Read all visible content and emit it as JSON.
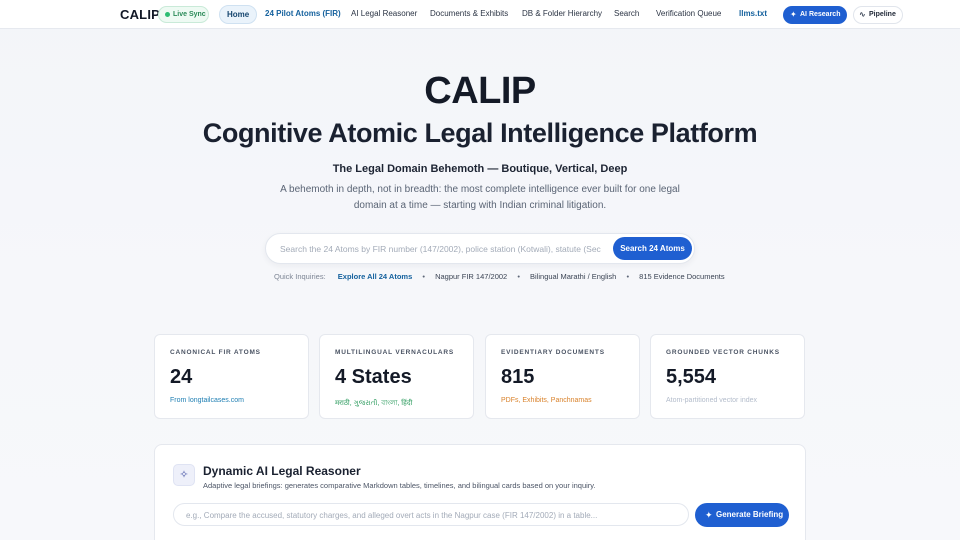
{
  "nav": {
    "brand": "CALIP",
    "live_badge": "Live Sync",
    "links": [
      {
        "label": "Home"
      },
      {
        "label": "24 Pilot Atoms (FIR)"
      },
      {
        "label": "AI Legal Reasoner"
      },
      {
        "label": "Documents & Exhibits"
      },
      {
        "label": "DB & Folder Hierarchy"
      },
      {
        "label": "Search"
      },
      {
        "label": "Verification Queue"
      },
      {
        "label": "llms.txt"
      }
    ],
    "research_button": "AI Research",
    "pipeline_button": "Pipeline"
  },
  "hero": {
    "title": "CALIP",
    "subtitle": "Cognitive Atomic Legal Intelligence Platform",
    "tagline": "The Legal Domain Behemoth — Boutique, Vertical, Deep",
    "description": "A behemoth in depth, not in breadth: the most complete intelligence ever built for one legal domain at a time — starting with Indian criminal litigation."
  },
  "search": {
    "placeholder": "Search the 24 Atoms by FIR number (147/2002), police station (Kotwali), statute (Sec 302)...",
    "button": "Search 24 Atoms"
  },
  "quick": {
    "label": "Quick Inquiries:",
    "items": [
      "Explore All 24 Atoms",
      "Nagpur FIR 147/2002",
      "Bilingual Marathi / English",
      "815 Evidence Documents"
    ]
  },
  "stats": [
    {
      "label": "CANONICAL FIR ATOMS",
      "value": "24",
      "foot": "From longtailcases.com",
      "foot_color": "#1f7fb3"
    },
    {
      "label": "MULTILINGUAL VERNACULARS",
      "value": "4 States",
      "foot": "मराठी, ગુજરાતી, বাংলা, हिंदी",
      "foot_color": "#2a9a5c"
    },
    {
      "label": "EVIDENTIARY DOCUMENTS",
      "value": "815",
      "foot": "PDFs, Exhibits, Panchnamas",
      "foot_color": "#d9822b"
    },
    {
      "label": "GROUNDED VECTOR CHUNKS",
      "value": "5,554",
      "foot": "Atom-partitioned vector index",
      "foot_color": "#b3bccb"
    }
  ],
  "reasoner": {
    "title": "Dynamic AI Legal Reasoner",
    "description": "Adaptive legal briefings: generates comparative Markdown tables, timelines, and bilingual cards based on your inquiry.",
    "placeholder": "e.g., Compare the accused, statutory charges, and alleged overt acts in the Nagpur case (FIR 147/2002) in a table...",
    "button": "Generate Briefing"
  }
}
